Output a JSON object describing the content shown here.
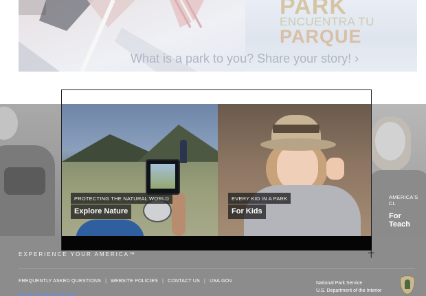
{
  "hero": {
    "brand_line1": "PARK",
    "brand_line2": "ENCUENTRA TU",
    "brand_line3": "PARQUE",
    "cta": "What is a park to you? Share your story! ›"
  },
  "carousel": {
    "cards": [
      {
        "kicker": "PROTECTING THE NATURAL WORLD",
        "title": "Explore Nature"
      },
      {
        "kicker": "EVERY KID IN A PARK",
        "title": "For Kids"
      },
      {
        "kicker": "AMERICA'S CL",
        "title": "For Teach"
      }
    ]
  },
  "footer": {
    "tagline": "EXPERIENCE YOUR AMERICA™",
    "links": [
      "FREQUENTLY ASKED QUESTIONS",
      "WEBSITE POLICIES",
      "CONTACT US",
      "USA.GOV"
    ],
    "separator": "|",
    "agency_line1": "National Park Service",
    "agency_line2": "U.S. Department of the Interior"
  },
  "icons": {
    "logo": "nps-arrowhead-icon",
    "cursor": "crosshair-icon"
  }
}
